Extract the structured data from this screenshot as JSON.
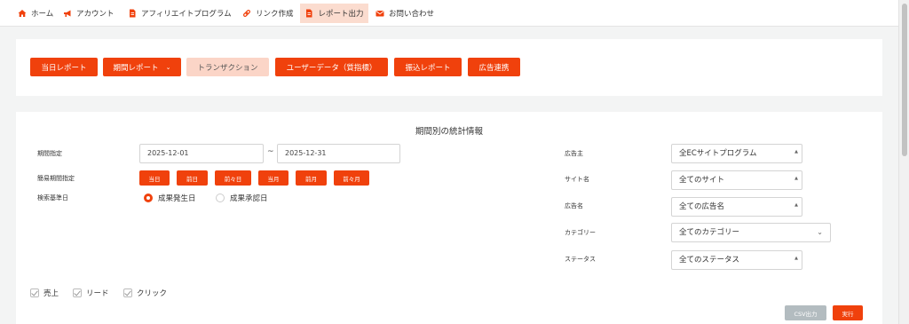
{
  "nav": {
    "items": [
      {
        "label": "ホーム",
        "icon": "home-icon"
      },
      {
        "label": "アカウント",
        "icon": "megaphone-icon"
      },
      {
        "label": "アフィリエイトプログラム",
        "icon": "document-icon"
      },
      {
        "label": "リンク作成",
        "icon": "link-icon"
      },
      {
        "label": "レポート出力",
        "icon": "report-icon"
      },
      {
        "label": "お問い合わせ",
        "icon": "mail-icon"
      }
    ]
  },
  "tabs": [
    "当日レポート",
    "期間レポート",
    "トランザクション",
    "ユーザーデータ（質指標）",
    "振込レポート",
    "広告連携"
  ],
  "section_title": "期間別の統計情報",
  "form": {
    "period_label": "期間指定",
    "date_from": "2025-12-01",
    "tilde": "~",
    "date_to": "2025-12-31",
    "quick_label": "簡易期間指定",
    "quick_buttons": [
      "当日",
      "前日",
      "前々日",
      "当月",
      "前月",
      "前々月"
    ],
    "basis_label": "検索基準日",
    "basis_options": [
      "成果発生日",
      "成果承認日"
    ]
  },
  "filters": {
    "advertiser_label": "広告主",
    "advertiser_value": "全ECサイトプログラム",
    "site_label": "サイト名",
    "site_value": "全てのサイト",
    "ad_label": "広告名",
    "ad_value": "全ての広告名",
    "category_label": "カテゴリー",
    "category_value": "全てのカテゴリー",
    "status_label": "ステータス",
    "status_value": "全てのステータス"
  },
  "checks": [
    "売上",
    "リード",
    "クリック"
  ],
  "actions": {
    "csv": "CSV出力",
    "run": "実行"
  },
  "colors": {
    "accent": "#f0410c",
    "accent_light": "#fbd5c7",
    "disabled": "#b3bcc0"
  }
}
